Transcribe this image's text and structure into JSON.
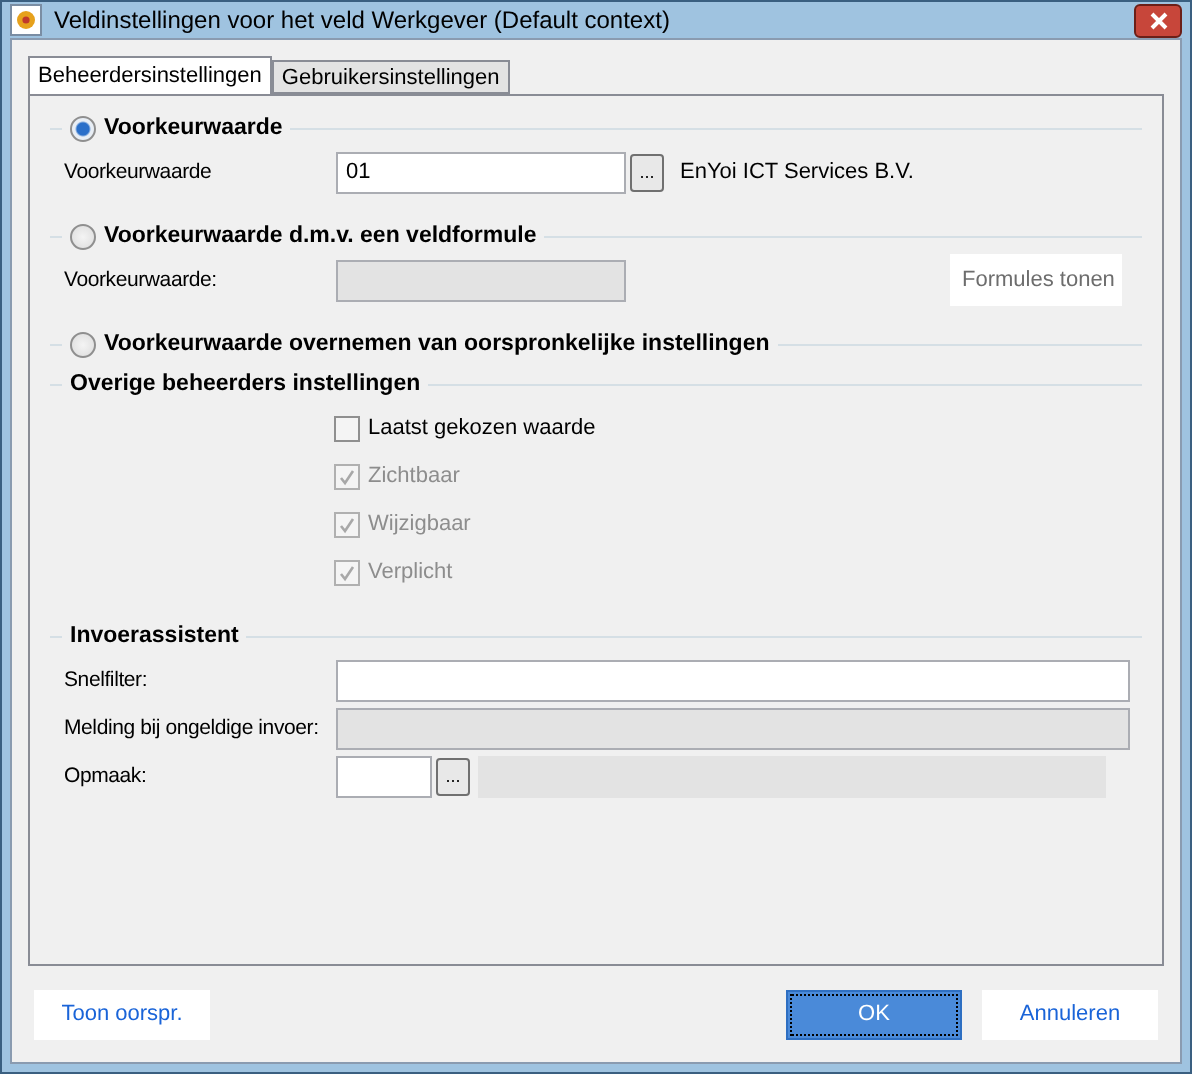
{
  "window": {
    "title": "Veldinstellingen voor het veld Werkgever (Default context)"
  },
  "tabs": [
    {
      "label": "Beheerdersinstellingen",
      "selected": true
    },
    {
      "label": "Gebruikersinstellingen",
      "selected": false
    }
  ],
  "default_options": [
    {
      "label": "Voorkeurwaarde",
      "selected": true,
      "field_label": "Voorkeurwaarde",
      "kind": "lookup",
      "value": "01",
      "disabled": false,
      "browse_button": "...",
      "description": "EnYoi ICT Services B.V."
    },
    {
      "label": "Voorkeurwaarde d.m.v. een veldformule",
      "selected": false,
      "field_label": "Voorkeurwaarde:",
      "kind": "formula",
      "disabled": true,
      "button": "Formules tonen"
    },
    {
      "label": "Voorkeurwaarde overnemen van oorspronkelijke instellingen",
      "selected": false,
      "kind": "none"
    }
  ],
  "other_settings": {
    "title": "Overige beheerders instellingen",
    "checkboxes": [
      {
        "label": "Laatst gekozen waarde",
        "checked": false,
        "disabled": false
      },
      {
        "label": "Zichtbaar",
        "checked": true,
        "disabled": true
      },
      {
        "label": "Wijzigbaar",
        "checked": true,
        "disabled": true
      },
      {
        "label": "Verplicht",
        "checked": true,
        "disabled": true
      }
    ]
  },
  "input_assistant": {
    "title": "Invoerassistent",
    "fields": [
      {
        "label": "Snelfilter:",
        "kind": "text",
        "disabled": false
      },
      {
        "label": "Melding bij ongeldige invoer:",
        "kind": "text",
        "disabled": true
      },
      {
        "label": "Opmaak:",
        "kind": "lookup",
        "disabled": false,
        "browse_button": "..."
      }
    ]
  },
  "buttons": [
    {
      "label": "Toon oorspr.",
      "default": false
    },
    {
      "label": "OK",
      "default": true
    },
    {
      "label": "Annuleren",
      "default": false
    }
  ]
}
